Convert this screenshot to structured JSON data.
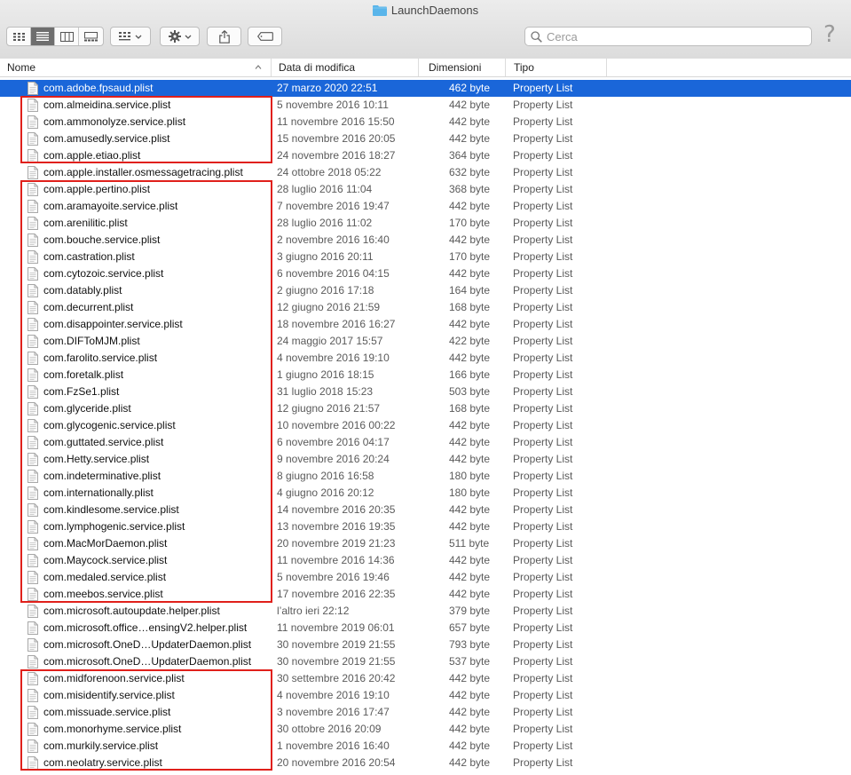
{
  "window": {
    "title": "LaunchDaemons",
    "folder_color": "#5ab5ea"
  },
  "search": {
    "placeholder": "Cerca"
  },
  "help_label": "?",
  "columns": {
    "name": "Nome",
    "date": "Data di modifica",
    "size": "Dimensioni",
    "kind": "Tipo"
  },
  "colors": {
    "selection": "#1a66d9",
    "highlight_box": "#e0201b"
  },
  "rows": [
    {
      "name": "com.adobe.fpsaud.plist",
      "date": "27 marzo 2020 22:51",
      "size": "462 byte",
      "kind": "Property List",
      "selected": true
    },
    {
      "name": "com.almeidina.service.plist",
      "date": "5 novembre 2016 10:11",
      "size": "442 byte",
      "kind": "Property List"
    },
    {
      "name": "com.ammonolyze.service.plist",
      "date": "11 novembre 2016 15:50",
      "size": "442 byte",
      "kind": "Property List"
    },
    {
      "name": "com.amusedly.service.plist",
      "date": "15 novembre 2016 20:05",
      "size": "442 byte",
      "kind": "Property List"
    },
    {
      "name": "com.apple.etiao.plist",
      "date": "24 novembre 2016 18:27",
      "size": "364 byte",
      "kind": "Property List"
    },
    {
      "name": "com.apple.installer.osmessagetracing.plist",
      "date": "24 ottobre 2018 05:22",
      "size": "632 byte",
      "kind": "Property List"
    },
    {
      "name": "com.apple.pertino.plist",
      "date": "28 luglio 2016 11:04",
      "size": "368 byte",
      "kind": "Property List"
    },
    {
      "name": "com.aramayoite.service.plist",
      "date": "7 novembre 2016 19:47",
      "size": "442 byte",
      "kind": "Property List"
    },
    {
      "name": "com.arenilitic.plist",
      "date": "28 luglio 2016 11:02",
      "size": "170 byte",
      "kind": "Property List"
    },
    {
      "name": "com.bouche.service.plist",
      "date": "2 novembre 2016 16:40",
      "size": "442 byte",
      "kind": "Property List"
    },
    {
      "name": "com.castration.plist",
      "date": "3 giugno 2016 20:11",
      "size": "170 byte",
      "kind": "Property List"
    },
    {
      "name": "com.cytozoic.service.plist",
      "date": "6 novembre 2016 04:15",
      "size": "442 byte",
      "kind": "Property List"
    },
    {
      "name": "com.datably.plist",
      "date": "2 giugno 2016 17:18",
      "size": "164 byte",
      "kind": "Property List"
    },
    {
      "name": "com.decurrent.plist",
      "date": "12 giugno 2016 21:59",
      "size": "168 byte",
      "kind": "Property List"
    },
    {
      "name": "com.disappointer.service.plist",
      "date": "18 novembre 2016 16:27",
      "size": "442 byte",
      "kind": "Property List"
    },
    {
      "name": "com.DIFToMJM.plist",
      "date": "24 maggio 2017 15:57",
      "size": "422 byte",
      "kind": "Property List"
    },
    {
      "name": "com.farolito.service.plist",
      "date": "4 novembre 2016 19:10",
      "size": "442 byte",
      "kind": "Property List"
    },
    {
      "name": "com.foretalk.plist",
      "date": "1 giugno 2016 18:15",
      "size": "166 byte",
      "kind": "Property List"
    },
    {
      "name": "com.FzSe1.plist",
      "date": "31 luglio 2018 15:23",
      "size": "503 byte",
      "kind": "Property List"
    },
    {
      "name": "com.glyceride.plist",
      "date": "12 giugno 2016 21:57",
      "size": "168 byte",
      "kind": "Property List"
    },
    {
      "name": "com.glycogenic.service.plist",
      "date": "10 novembre 2016 00:22",
      "size": "442 byte",
      "kind": "Property List"
    },
    {
      "name": "com.guttated.service.plist",
      "date": "6 novembre 2016 04:17",
      "size": "442 byte",
      "kind": "Property List"
    },
    {
      "name": "com.Hetty.service.plist",
      "date": "9 novembre 2016 20:24",
      "size": "442 byte",
      "kind": "Property List"
    },
    {
      "name": "com.indeterminative.plist",
      "date": "8 giugno 2016 16:58",
      "size": "180 byte",
      "kind": "Property List"
    },
    {
      "name": "com.internationally.plist",
      "date": "4 giugno 2016 20:12",
      "size": "180 byte",
      "kind": "Property List"
    },
    {
      "name": "com.kindlesome.service.plist",
      "date": "14 novembre 2016 20:35",
      "size": "442 byte",
      "kind": "Property List"
    },
    {
      "name": "com.lymphogenic.service.plist",
      "date": "13 novembre 2016 19:35",
      "size": "442 byte",
      "kind": "Property List"
    },
    {
      "name": "com.MacMorDaemon.plist",
      "date": "20 novembre 2019 21:23",
      "size": "511 byte",
      "kind": "Property List"
    },
    {
      "name": "com.Maycock.service.plist",
      "date": "11 novembre 2016 14:36",
      "size": "442 byte",
      "kind": "Property List"
    },
    {
      "name": "com.medaled.service.plist",
      "date": "5 novembre 2016 19:46",
      "size": "442 byte",
      "kind": "Property List"
    },
    {
      "name": "com.meebos.service.plist",
      "date": "17 novembre 2016 22:35",
      "size": "442 byte",
      "kind": "Property List"
    },
    {
      "name": "com.microsoft.autoupdate.helper.plist",
      "date": "l’altro ieri 22:12",
      "size": "379 byte",
      "kind": "Property List"
    },
    {
      "name": "com.microsoft.office…ensingV2.helper.plist",
      "date": "11 novembre 2019 06:01",
      "size": "657 byte",
      "kind": "Property List"
    },
    {
      "name": "com.microsoft.OneD…UpdaterDaemon.plist",
      "date": "30 novembre 2019 21:55",
      "size": "793 byte",
      "kind": "Property List"
    },
    {
      "name": "com.microsoft.OneD…UpdaterDaemon.plist",
      "date": "30 novembre 2019 21:55",
      "size": "537 byte",
      "kind": "Property List"
    },
    {
      "name": "com.midforenoon.service.plist",
      "date": "30 settembre 2016 20:42",
      "size": "442 byte",
      "kind": "Property List"
    },
    {
      "name": "com.misidentify.service.plist",
      "date": "4 novembre 2016 19:10",
      "size": "442 byte",
      "kind": "Property List"
    },
    {
      "name": "com.missuade.service.plist",
      "date": "3 novembre 2016 17:47",
      "size": "442 byte",
      "kind": "Property List"
    },
    {
      "name": "com.monorhyme.service.plist",
      "date": "30 ottobre 2016 20:09",
      "size": "442 byte",
      "kind": "Property List"
    },
    {
      "name": "com.murkily.service.plist",
      "date": "1 novembre 2016 16:40",
      "size": "442 byte",
      "kind": "Property List"
    },
    {
      "name": "com.neolatry.service.plist",
      "date": "20 novembre 2016 20:54",
      "size": "442 byte",
      "kind": "Property List"
    }
  ]
}
